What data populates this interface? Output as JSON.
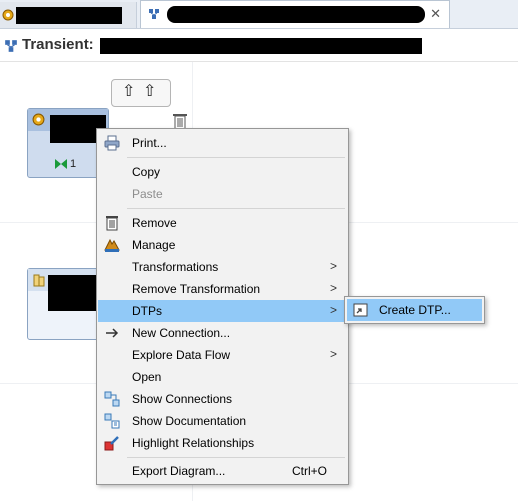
{
  "tabs": {
    "tab1": {
      "label": ""
    },
    "tab2": {
      "label": ""
    }
  },
  "editor": {
    "title_prefix": "Transient:"
  },
  "diagram": {
    "node1": {
      "count": "1"
    }
  },
  "context_menu": {
    "items": [
      {
        "label": "Print...",
        "icon": "print-icon"
      },
      {
        "label": "Copy"
      },
      {
        "label": "Paste",
        "disabled": true
      },
      {
        "label": "Remove",
        "icon": "trash-icon"
      },
      {
        "label": "Manage",
        "icon": "manage-icon"
      },
      {
        "label": "Transformations",
        "submenu": true
      },
      {
        "label": "Remove Transformation",
        "submenu": true
      },
      {
        "label": "DTPs",
        "submenu": true,
        "selected": true
      },
      {
        "label": "New Connection...",
        "icon": "arrow-right-icon"
      },
      {
        "label": "Explore Data Flow",
        "submenu": true
      },
      {
        "label": "Open"
      },
      {
        "label": "Show Connections",
        "icon": "connections-icon"
      },
      {
        "label": "Show Documentation",
        "icon": "documentation-icon"
      },
      {
        "label": "Highlight Relationships",
        "icon": "highlight-icon"
      },
      {
        "label": "Export Diagram...",
        "shortcut": "Ctrl+O"
      }
    ],
    "submenu_arrow": ">"
  },
  "dtp_submenu": {
    "items": [
      {
        "label": "Create DTP...",
        "icon": "create-dtp-icon",
        "selected": true
      }
    ]
  },
  "colors": {
    "selection": "#91c9f7",
    "menu_bg": "#f2f2f2",
    "node_fill": "#cfdcee"
  }
}
